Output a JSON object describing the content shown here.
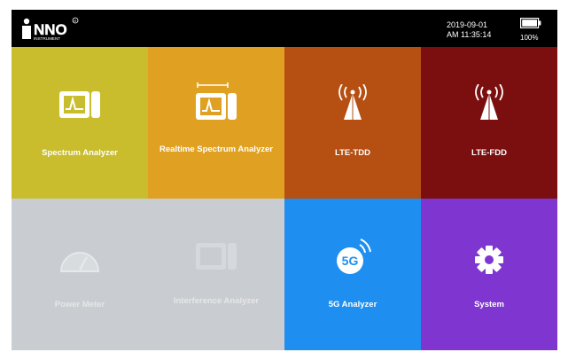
{
  "header": {
    "date": "2019-09-01",
    "time": "AM 11:35:14",
    "battery": "100%",
    "brand": "INNO",
    "brand_sub": "INSTRUMENT"
  },
  "tiles": [
    {
      "label": "Spectrum Analyzer",
      "color": "#c9bd2e",
      "icon": "spectrum-analyzer-icon",
      "enabled": true
    },
    {
      "label": "Realtime Spectrum Analyzer",
      "color": "#e0a123",
      "icon": "realtime-spectrum-icon",
      "enabled": true
    },
    {
      "label": "LTE-TDD",
      "color": "#b54f12",
      "icon": "antenna-icon",
      "enabled": true
    },
    {
      "label": "LTE-FDD",
      "color": "#7b0f0f",
      "icon": "antenna-icon",
      "enabled": true
    },
    {
      "label": "Power Meter",
      "color": "#c9cdd2",
      "icon": "gauge-icon",
      "enabled": false
    },
    {
      "label": "Interference Analyzer",
      "color": "#c9cdd2",
      "icon": "interference-icon",
      "enabled": false
    },
    {
      "label": "5G Analyzer",
      "color": "#1e8ff0",
      "icon": "5g-icon",
      "enabled": true
    },
    {
      "label": "System",
      "color": "#7f35cf",
      "icon": "gear-icon",
      "enabled": true
    }
  ]
}
